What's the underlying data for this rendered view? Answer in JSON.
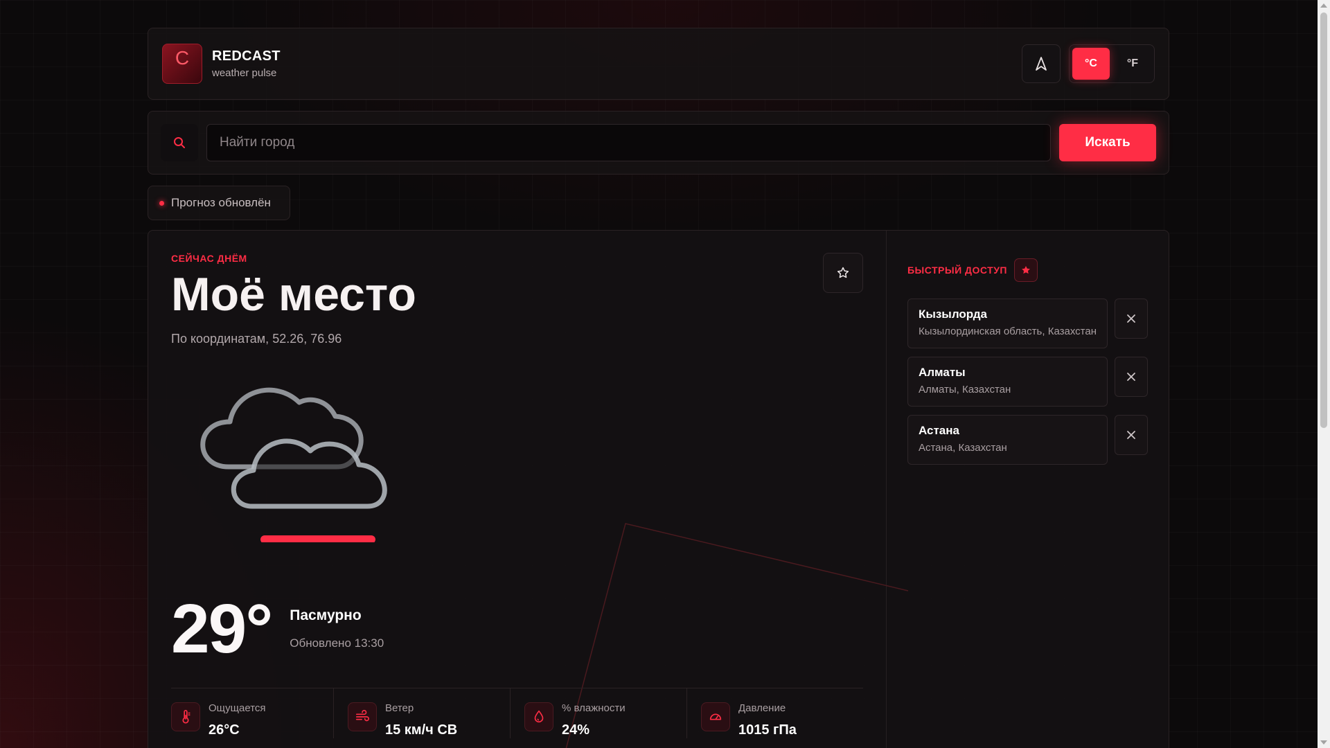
{
  "header": {
    "brand_letter": "C",
    "brand_name": "REDCAST",
    "brand_sub": "weather pulse",
    "unit_c": "°C",
    "unit_f": "°F",
    "active_unit": "°C"
  },
  "search": {
    "placeholder": "Найти город",
    "button_label": "Искать"
  },
  "status": {
    "text": "Прогноз обновлён"
  },
  "current": {
    "eyebrow": "СЕЙЧАС ДНЁМ",
    "title": "Моё место",
    "coords": "По координатам, 52.26, 76.96",
    "temperature": "29°",
    "condition": "Пасмурно",
    "updated": "Обновлено 13:30",
    "icon": "cloud-icon"
  },
  "stats": [
    {
      "icon": "thermometer-icon",
      "label": "Ощущается",
      "value": "26°C"
    },
    {
      "icon": "wind-icon",
      "label": "Ветер",
      "value": "15 км/ч СВ"
    },
    {
      "icon": "droplet-icon",
      "label": "% влажности",
      "value": "24%"
    },
    {
      "icon": "gauge-icon",
      "label": "Давление",
      "value": "1015 гПа"
    }
  ],
  "quick_access": {
    "title": "БЫСТРЫЙ ДОСТУП",
    "items": [
      {
        "name": "Кызылорда",
        "region": "Кызылординская область, Казахстан"
      },
      {
        "name": "Алматы",
        "region": "Алматы, Казахстан"
      },
      {
        "name": "Астана",
        "region": "Астана, Казахстан"
      }
    ]
  },
  "colors": {
    "accent": "#ff2d45",
    "background": "#0c0a0b",
    "panel": "#161214",
    "cloud_stroke": "#b9bec4"
  }
}
